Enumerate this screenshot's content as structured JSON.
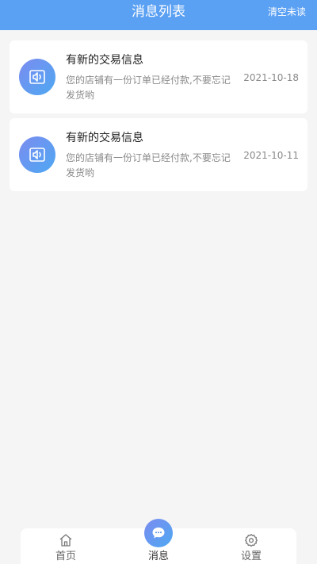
{
  "header": {
    "title": "消息列表",
    "clear_label": "清空未读",
    "background": "#5aa0f3"
  },
  "messages": [
    {
      "title": "有新的交易信息",
      "body": "您的店铺有一份订单已经付款,不要忘记发货哟",
      "date": "2021-10-18",
      "icon": "speaker-icon"
    },
    {
      "title": "有新的交易信息",
      "body": "您的店铺有一份订单已经付款,不要忘记发货哟",
      "date": "2021-10-11",
      "icon": "speaker-icon"
    }
  ],
  "bottom_nav": {
    "items": [
      {
        "label": "首页",
        "icon": "home-icon",
        "active": false
      },
      {
        "label": "消息",
        "icon": "chat-bubble-icon",
        "active": true
      },
      {
        "label": "设置",
        "icon": "gear-icon",
        "active": false
      }
    ]
  },
  "colors": {
    "accent_start": "#7b8cf0",
    "accent_end": "#4ea8f2"
  }
}
